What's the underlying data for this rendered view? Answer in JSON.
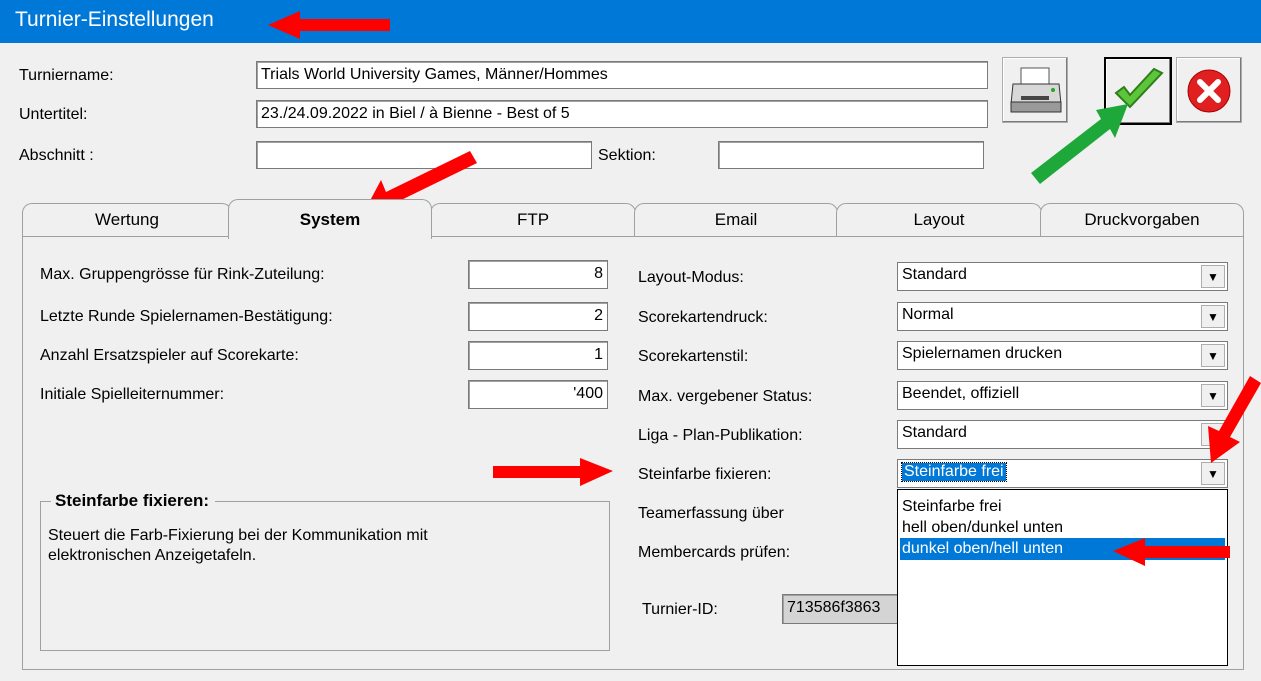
{
  "window": {
    "title": "Turnier-Einstellungen"
  },
  "header": {
    "tournament_name_label": "Turniername:",
    "tournament_name_value": "Trials World University Games, Männer/Hommes",
    "subtitle_label": "Untertitel:",
    "subtitle_value": "23./24.09.2022 in Biel / à Bienne - Best of 5",
    "section_label": "Abschnitt :",
    "section_value": "",
    "sektion_label": "Sektion:",
    "sektion_value": ""
  },
  "tabs": [
    "Wertung",
    "System",
    "FTP",
    "Email",
    "Layout",
    "Druckvorgaben"
  ],
  "active_tab": "System",
  "left_fields": [
    {
      "label": "Max. Gruppengrösse für Rink-Zuteilung:",
      "value": "8"
    },
    {
      "label": "Letzte Runde Spielernamen-Bestätigung:",
      "value": "2"
    },
    {
      "label": "Anzahl Ersatzspieler auf Scorekarte:",
      "value": "1"
    },
    {
      "label": "Initiale Spielleiternummer:",
      "value": "'400"
    }
  ],
  "right_fields": [
    {
      "label": "Layout-Modus:",
      "value": "Standard"
    },
    {
      "label": "Scorekartendruck:",
      "value": "Normal"
    },
    {
      "label": "Scorekartenstil:",
      "value": "Spielernamen drucken"
    },
    {
      "label": "Max. vergebener Status:",
      "value": "Beendet, offiziell"
    },
    {
      "label": "Liga - Plan-Publikation:",
      "value": "Standard"
    },
    {
      "label": "Steinfarbe fixieren:",
      "value": "Steinfarbe frei"
    },
    {
      "label": "Teamerfassung über",
      "value": ""
    },
    {
      "label": "Membercards prüfen:",
      "value": ""
    }
  ],
  "tournament_id": {
    "label": "Turnier-ID:",
    "value": "713586f3863"
  },
  "dropdown_options": [
    "Steinfarbe frei",
    "hell oben/dunkel unten",
    "dunkel oben/hell unten"
  ],
  "dropdown_selected": "dunkel oben/hell unten",
  "info_group": {
    "title": "Steinfarbe fixieren:",
    "text_line1": "Steuert die Farb-Fixierung bei der Kommunikation mit",
    "text_line2": "elektronischen Anzeigetafeln."
  },
  "icons": {
    "print": "printer-icon",
    "ok": "green-check-icon",
    "cancel": "red-x-icon",
    "dropdown": "down-arrow-icon"
  },
  "colors": {
    "titlebar": "#0078d7",
    "selection": "#0078d7",
    "annotation_red": "#ff0000",
    "annotation_green": "#1fa83a"
  }
}
